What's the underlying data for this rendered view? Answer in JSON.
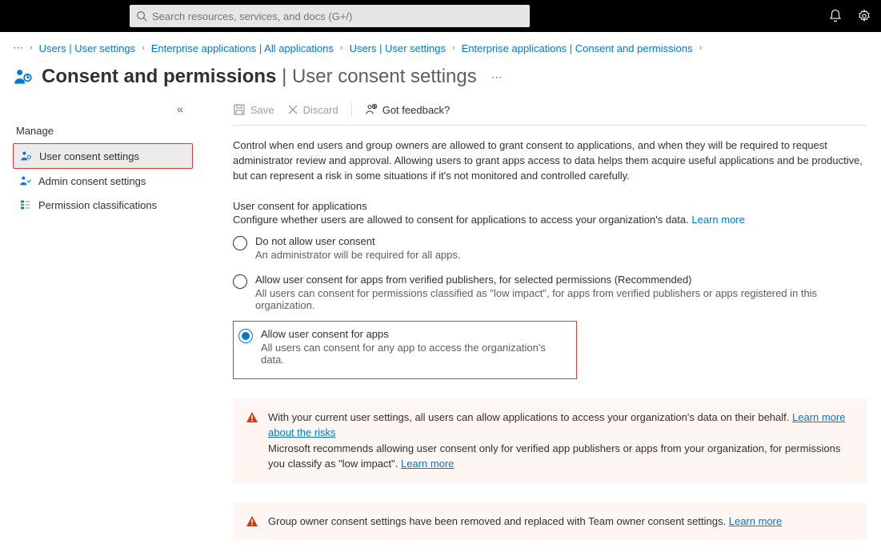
{
  "search": {
    "placeholder": "Search resources, services, and docs (G+/)"
  },
  "breadcrumb": {
    "items": [
      "Users | User settings",
      "Enterprise applications | All applications",
      "Users | User settings",
      "Enterprise applications | Consent and permissions"
    ]
  },
  "title": {
    "main": "Consent and permissions",
    "sub": "User consent settings"
  },
  "sidebar": {
    "heading": "Manage",
    "items": [
      {
        "label": "User consent settings"
      },
      {
        "label": "Admin consent settings"
      },
      {
        "label": "Permission classifications"
      }
    ]
  },
  "toolbar": {
    "save": "Save",
    "discard": "Discard",
    "feedback": "Got feedback?"
  },
  "intro": "Control when end users and group owners are allowed to grant consent to applications, and when they will be required to request administrator review and approval. Allowing users to grant apps access to data helps them acquire useful applications and be productive, but can represent a risk in some situations if it's not monitored and controlled carefully.",
  "section": {
    "heading": "User consent for applications",
    "sub": "Configure whether users are allowed to consent for applications to access your organization's data.",
    "learn_more": "Learn more"
  },
  "radios": [
    {
      "title": "Do not allow user consent",
      "desc": "An administrator will be required for all apps."
    },
    {
      "title": "Allow user consent for apps from verified publishers, for selected permissions (Recommended)",
      "desc": "All users can consent for permissions classified as \"low impact\", for apps from verified publishers or apps registered in this organization."
    },
    {
      "title": "Allow user consent for apps",
      "desc": "All users can consent for any app to access the organization's data."
    }
  ],
  "warnings": {
    "w1a": "With your current user settings, all users can allow applications to access your organization's data on their behalf.",
    "w1link1": "Learn more about the risks",
    "w1b": "Microsoft recommends allowing user consent only for verified app publishers or apps from your organization, for permissions you classify as \"low impact\".",
    "w1link2": "Learn more",
    "w2": "Group owner consent settings have been removed and replaced with Team owner consent settings.",
    "w2link": "Learn more"
  }
}
